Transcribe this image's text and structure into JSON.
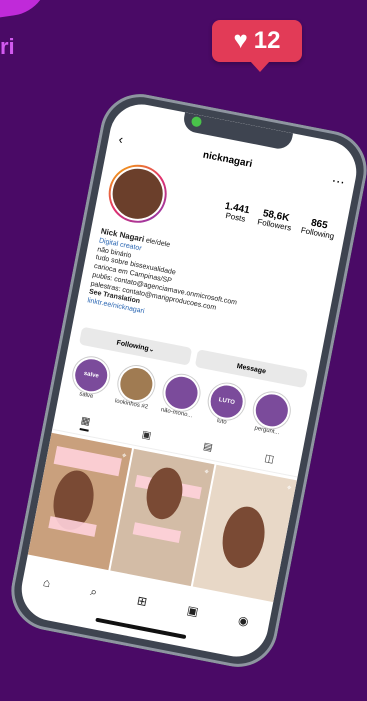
{
  "canvas": {
    "corner_text": "ri"
  },
  "notification": {
    "count": "12",
    "icon": "heart-icon"
  },
  "app": {
    "username": "nicknagari",
    "stats": [
      {
        "value": "1.441",
        "label": "Posts"
      },
      {
        "value": "58,6K",
        "label": "Followers"
      },
      {
        "value": "865",
        "label": "Following"
      }
    ],
    "bio": {
      "name": "Nick Nagari",
      "pronouns": "ele/dele",
      "category": "Digital creator",
      "line1": "não binário",
      "line2": "tudo sobre bissexualidade",
      "line3": "carioca em Campinas/SP",
      "line4": "publis: contato@agenciamave.onmicrosoft.com",
      "line5": "palestras: contato@marigproducoes.com",
      "translation": "See Translation",
      "link": "linktr.ee/nicknagari"
    },
    "buttons": {
      "following": "Following",
      "message": "Message"
    },
    "highlights": [
      {
        "label": "salve",
        "text": "salve"
      },
      {
        "label": "lookinhos #2",
        "text": ""
      },
      {
        "label": "não-mono...",
        "text": ""
      },
      {
        "label": "luto",
        "text": "LUTO"
      },
      {
        "label": "pergunt...",
        "text": ""
      }
    ],
    "tabs": [
      "grid-icon",
      "reels-icon",
      "guides-icon",
      "tagged-icon"
    ],
    "bottom_nav": [
      "home-icon",
      "search-icon",
      "new-post-icon",
      "reels-icon",
      "profile-icon"
    ]
  }
}
